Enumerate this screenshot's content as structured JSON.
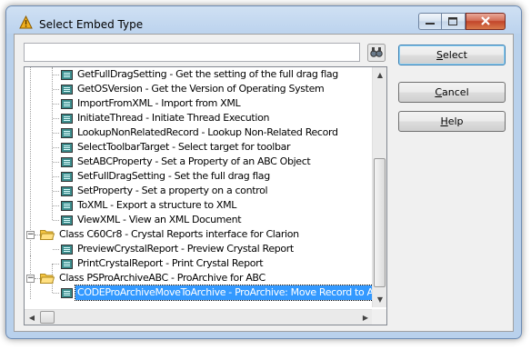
{
  "window": {
    "title": "Select Embed Type"
  },
  "search": {
    "value": "",
    "placeholder": ""
  },
  "buttons": {
    "select_mnemonic": "S",
    "select_rest": "elect",
    "cancel_mnemonic": "C",
    "cancel_rest": "ancel",
    "help_mnemonic": "H",
    "help_rest": "elp"
  },
  "tree": {
    "items": [
      {
        "label": "GetFullDragSetting - Get the setting of the full drag flag"
      },
      {
        "label": "GetOSVersion - Get the Version of Operating System"
      },
      {
        "label": "ImportFromXML - Import from XML"
      },
      {
        "label": "InitiateThread - Initiate Thread Execution"
      },
      {
        "label": "LookupNonRelatedRecord - Lookup Non-Related Record"
      },
      {
        "label": "SelectToolbarTarget - Select target for toolbar"
      },
      {
        "label": "SetABCProperty - Set a Property of an ABC Object"
      },
      {
        "label": "SetFullDragSetting - Set the full drag flag"
      },
      {
        "label": "SetProperty - Set a property on a control"
      },
      {
        "label": "ToXML - Export a structure to XML"
      },
      {
        "label": "ViewXML - View an XML Document"
      },
      {
        "label": "Class C60Cr8 - Crystal Reports interface for Clarion"
      },
      {
        "label": "PreviewCrystalReport - Preview Crystal Report"
      },
      {
        "label": "PrintCrystalReport - Print Crystal Report"
      },
      {
        "label": "Class PSProArchiveABC - ProArchive for ABC"
      },
      {
        "label": "CODEProArchiveMoveToArchive - ProArchive: Move Record to Archive"
      }
    ]
  },
  "colors": {
    "selection": "#3399ff",
    "folder": "#f5c542",
    "embed_icon": "#3c8c8c"
  },
  "icons": {
    "app": "warning-triangle-icon",
    "search": "binoculars-icon",
    "folder": "open-folder-icon",
    "embed": "embed-method-icon"
  }
}
